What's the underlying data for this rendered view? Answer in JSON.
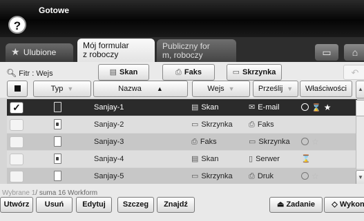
{
  "header": {
    "status": "Gotowe",
    "help_glyph": "?"
  },
  "tabs": [
    {
      "label": "Ulubione",
      "active": false,
      "icon": "star-icon"
    },
    {
      "label": "Mój formular z roboczy",
      "line1": "Mój formular",
      "line2": "z roboczy",
      "active": true
    },
    {
      "label": "Publiczny for m, roboczy",
      "line1": "Publiczny for",
      "line2": "m, roboczy",
      "active": false
    }
  ],
  "filter": {
    "label": "Fitr : Wejs",
    "buttons": [
      {
        "label": "Skan",
        "icon": "scan-icon"
      },
      {
        "label": "Faks",
        "icon": "fax-icon"
      },
      {
        "label": "Skrzynka",
        "icon": "box-icon"
      }
    ]
  },
  "table": {
    "columns": [
      "Typ",
      "Nazwa",
      "Wejs",
      "Prześlij",
      "Właściwości"
    ],
    "rows": [
      {
        "name": "Sanjay-1",
        "dest": "Skan",
        "dest_icon": "scan-icon",
        "send": "E-mail",
        "send_icon": "email-icon",
        "props": "clock,hourglass,star",
        "selected": true,
        "locked": false
      },
      {
        "name": "Sanjay-2",
        "dest": "Skrzynka",
        "dest_icon": "box-icon",
        "send": "Faks",
        "send_icon": "fax-icon",
        "props": "",
        "selected": false,
        "locked": true
      },
      {
        "name": "Sanjay-3",
        "dest": "Faks",
        "dest_icon": "fax-icon",
        "send": "Skrzynka",
        "send_icon": "box-icon",
        "props": "clock,star",
        "selected": false,
        "locked": false
      },
      {
        "name": "Sanjay-4",
        "dest": "Skan",
        "dest_icon": "scan-icon",
        "send": "Serwer",
        "send_icon": "server-icon",
        "props": "hourglass",
        "selected": false,
        "locked": true
      },
      {
        "name": "Sanjay-5",
        "dest": "Skrzynka",
        "dest_icon": "box-icon",
        "send": "Druk",
        "send_icon": "print-icon",
        "props": "clock,star",
        "selected": false,
        "locked": false
      }
    ]
  },
  "footer": {
    "selected_count": "Wybrane 1",
    "total": "/ suma 16 Workform",
    "buttons": [
      "Utwórz",
      "Usuń",
      "Edytuj",
      "Szczeg",
      "Znajdź"
    ],
    "job_label": "Zadanie",
    "run_label": "Wykon"
  }
}
